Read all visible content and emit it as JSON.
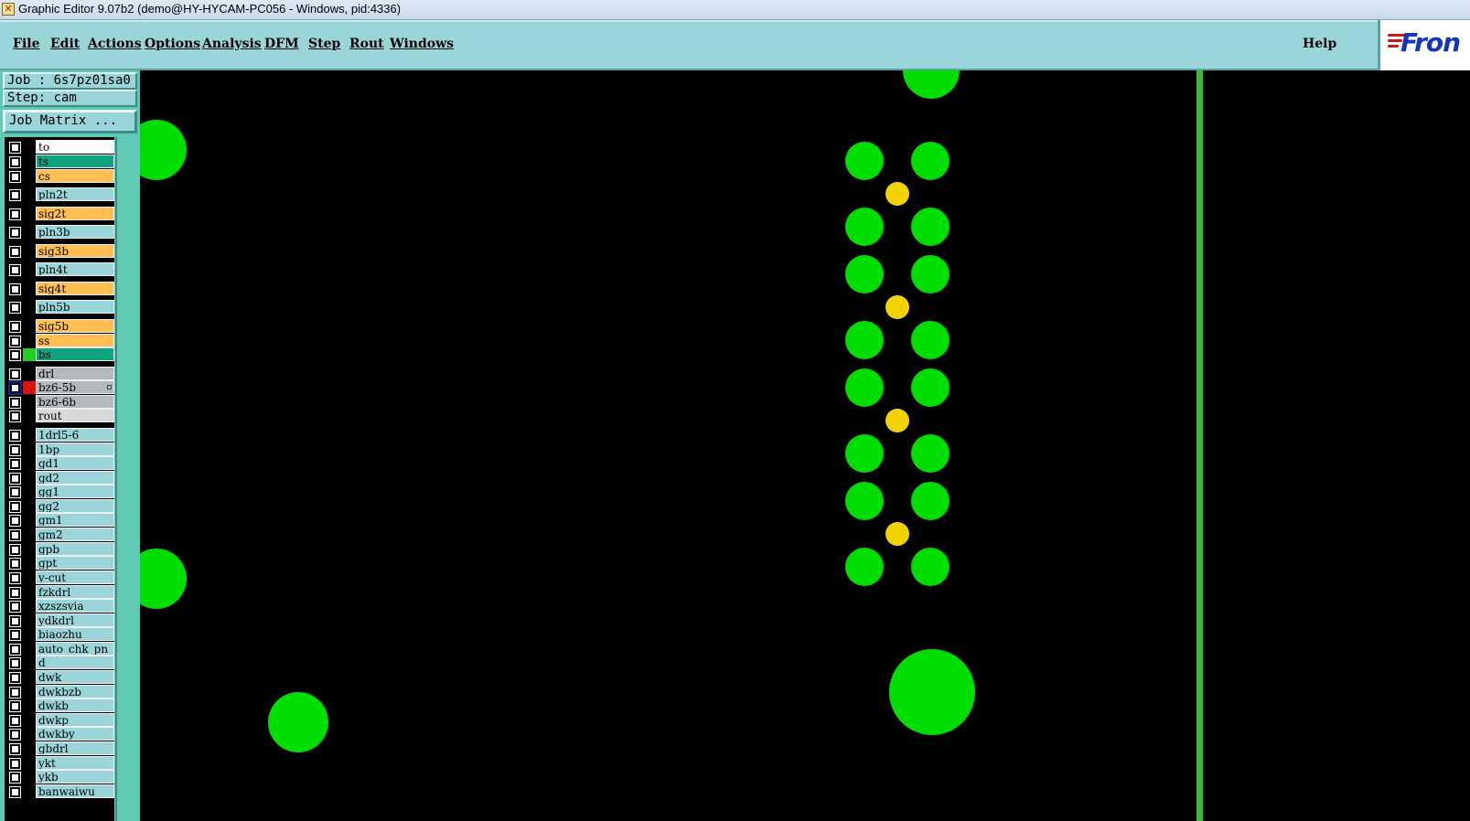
{
  "window": {
    "title": "Graphic Editor 9.07b2 (demo@HY-HYCAM-PC056 - Windows, pid:4336)",
    "icon": "app-icon"
  },
  "menu": {
    "items": [
      "File",
      "Edit",
      "Actions",
      "Options",
      "Analysis",
      "DFM",
      "Step",
      "Rout",
      "Windows"
    ],
    "help": "Help",
    "logo_text": "Fron"
  },
  "job": {
    "job_label": "Job : 6s7pz01sa0",
    "step_label": "Step: cam",
    "matrix_button": "Job Matrix ..."
  },
  "layers": [
    {
      "name": "to",
      "bg": "#ffffff",
      "swatch": "#000000"
    },
    {
      "name": "ts",
      "bg": "#10a37f",
      "swatch": "#000000"
    },
    {
      "name": "cs",
      "bg": "#ffbf52",
      "swatch": "#000000"
    },
    {
      "name": "pln2t",
      "bg": "#9ad6d9",
      "swatch": "#000000"
    },
    {
      "name": "sig2t",
      "bg": "#ffbf52",
      "swatch": "#000000"
    },
    {
      "name": "pln3b",
      "bg": "#9ad6d9",
      "swatch": "#000000"
    },
    {
      "name": "sig3b",
      "bg": "#ffbf52",
      "swatch": "#000000"
    },
    {
      "name": "pln4t",
      "bg": "#9ad6d9",
      "swatch": "#000000"
    },
    {
      "name": "sig4t",
      "bg": "#ffbf52",
      "swatch": "#000000"
    },
    {
      "name": "pln5b",
      "bg": "#9ad6d9",
      "swatch": "#000000"
    },
    {
      "name": "sig5b",
      "bg": "#ffbf52",
      "swatch": "#000000"
    },
    {
      "name": "ss",
      "bg": "#ffbf52",
      "swatch": "#000000"
    },
    {
      "name": "bs",
      "bg": "#10a37f",
      "swatch": "#22cc22"
    },
    {
      "name": "drl",
      "bg": "#b3b9bd",
      "swatch": "#000000"
    },
    {
      "name": "bz6-5b",
      "bg": "#b3b9bd",
      "swatch": "#e01010",
      "active": true
    },
    {
      "name": "bz6-6b",
      "bg": "#b3b9bd",
      "swatch": "#000000"
    },
    {
      "name": "rout",
      "bg": "#d8d8d8",
      "swatch": "#000000"
    },
    {
      "name": "1drl5-6",
      "bg": "#9ad6d9",
      "swatch": "#000000"
    },
    {
      "name": "1bp",
      "bg": "#9ad6d9",
      "swatch": "#000000"
    },
    {
      "name": "gd1",
      "bg": "#9ad6d9",
      "swatch": "#000000"
    },
    {
      "name": "gd2",
      "bg": "#9ad6d9",
      "swatch": "#000000"
    },
    {
      "name": "gg1",
      "bg": "#9ad6d9",
      "swatch": "#000000"
    },
    {
      "name": "gg2",
      "bg": "#9ad6d9",
      "swatch": "#000000"
    },
    {
      "name": "gm1",
      "bg": "#9ad6d9",
      "swatch": "#000000"
    },
    {
      "name": "gm2",
      "bg": "#9ad6d9",
      "swatch": "#000000"
    },
    {
      "name": "gpb",
      "bg": "#9ad6d9",
      "swatch": "#000000"
    },
    {
      "name": "gpt",
      "bg": "#9ad6d9",
      "swatch": "#000000"
    },
    {
      "name": "v-cut",
      "bg": "#9ad6d9",
      "swatch": "#000000"
    },
    {
      "name": "fzkdrl",
      "bg": "#9ad6d9",
      "swatch": "#000000"
    },
    {
      "name": "xzszsvia",
      "bg": "#9ad6d9",
      "swatch": "#000000"
    },
    {
      "name": "ydkdrl",
      "bg": "#9ad6d9",
      "swatch": "#000000"
    },
    {
      "name": "biaozhu",
      "bg": "#9ad6d9",
      "swatch": "#000000"
    },
    {
      "name": "auto_chk_pn",
      "bg": "#9ad6d9",
      "swatch": "#000000"
    },
    {
      "name": "d",
      "bg": "#9ad6d9",
      "swatch": "#000000"
    },
    {
      "name": "dwk",
      "bg": "#9ad6d9",
      "swatch": "#000000"
    },
    {
      "name": "dwkbzb",
      "bg": "#9ad6d9",
      "swatch": "#000000"
    },
    {
      "name": "dwkb",
      "bg": "#9ad6d9",
      "swatch": "#000000"
    },
    {
      "name": "dwkp",
      "bg": "#9ad6d9",
      "swatch": "#000000"
    },
    {
      "name": "dwkby",
      "bg": "#9ad6d9",
      "swatch": "#000000"
    },
    {
      "name": "gbdrl",
      "bg": "#9ad6d9",
      "swatch": "#000000"
    },
    {
      "name": "ykt",
      "bg": "#9ad6d9",
      "swatch": "#000000"
    },
    {
      "name": "ykb",
      "bg": "#9ad6d9",
      "swatch": "#000000"
    },
    {
      "name": "banwaiwu",
      "bg": "#9ad6d9",
      "swatch": "#000000"
    }
  ],
  "colors": {
    "pad_green": "#00dd00",
    "via_yellow": "#f2d200",
    "rout_line": "#3cb83c",
    "panel_cyan": "#9ad6d9",
    "panel_teal": "#5fc9b3"
  }
}
